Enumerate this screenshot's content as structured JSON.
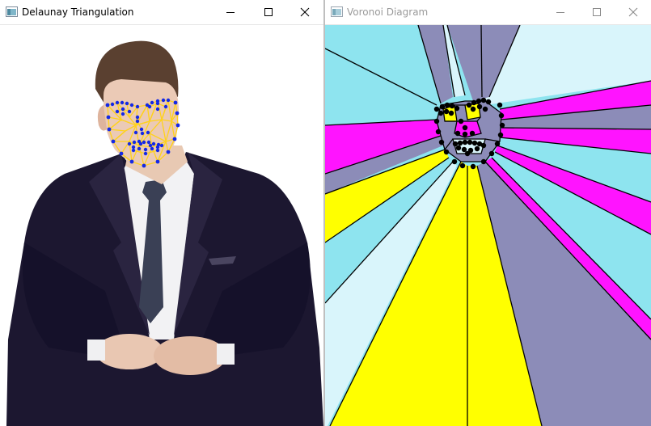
{
  "windows": [
    {
      "title": "Delaunay Triangulation",
      "active": true,
      "icon": "opencv-window-icon",
      "controls": [
        "minimize-icon",
        "maximize-icon",
        "close-icon"
      ]
    },
    {
      "title": "Voronoi Diagram",
      "active": false,
      "icon": "opencv-window-icon",
      "controls": [
        "minimize-icon",
        "maximize-icon",
        "close-icon"
      ]
    }
  ],
  "colors": {
    "delaunay_edges": "#ffd21a",
    "landmarks": "#1428e6",
    "voronoi_cyan": "#8ee4ef",
    "voronoi_light_cyan": "#d9f5fb",
    "voronoi_magenta": "#ff14ff",
    "voronoi_yellow": "#ffff00",
    "voronoi_slate": "#8c8cb8",
    "voronoi_edges": "#000000"
  }
}
